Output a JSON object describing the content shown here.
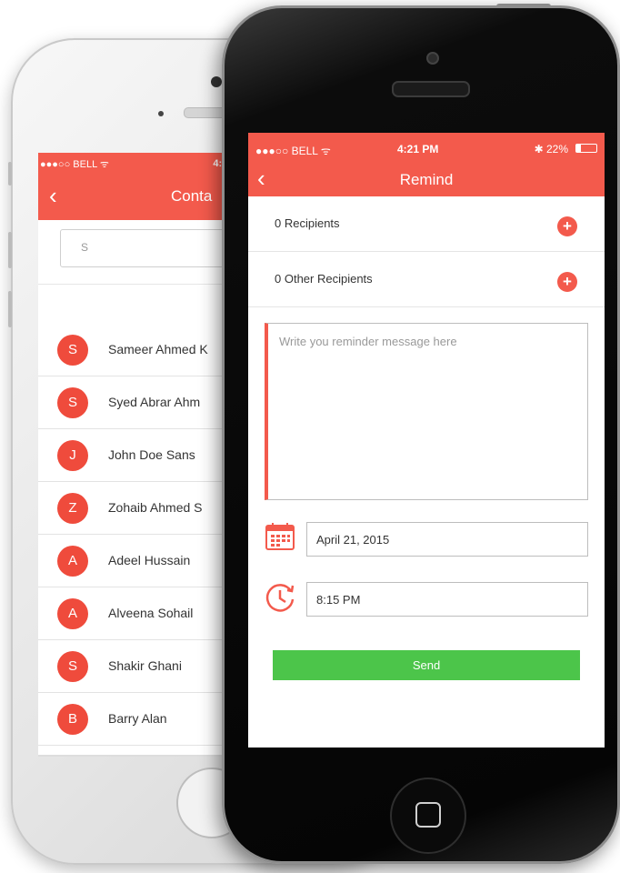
{
  "back_phone": {
    "status": {
      "carrier": "●●●○○ BELL ᯤ",
      "time": "4:21 PM"
    },
    "nav": {
      "back": "‹",
      "title": "Conta"
    },
    "search": {
      "value": "S"
    },
    "contacts": [
      {
        "initial": "S",
        "name": "Sameer Ahmed K"
      },
      {
        "initial": "S",
        "name": "Syed Abrar Ahm"
      },
      {
        "initial": "J",
        "name": "John Doe Sans"
      },
      {
        "initial": "Z",
        "name": "Zohaib Ahmed S"
      },
      {
        "initial": "A",
        "name": "Adeel Hussain"
      },
      {
        "initial": "A",
        "name": "Alveena Sohail"
      },
      {
        "initial": "S",
        "name": "Shakir Ghani"
      },
      {
        "initial": "B",
        "name": "Barry Alan"
      }
    ]
  },
  "front_phone": {
    "status": {
      "carrier": "●●●○○ BELL ᯤ",
      "time": "4:21 PM",
      "battery_text": "✱ 22%",
      "battery_level": 0.22
    },
    "nav": {
      "back": "‹",
      "title": "Remind"
    },
    "recipients": {
      "label": "0 Recipients",
      "add": "+"
    },
    "other_recipients": {
      "label": "0 Other Recipients",
      "add": "+"
    },
    "message": {
      "placeholder": "Write you reminder message here"
    },
    "date": {
      "value": "April 21, 2015",
      "icon": "calendar-icon"
    },
    "time": {
      "value": "8:15 PM",
      "icon": "clock-icon"
    },
    "send_label": "Send"
  },
  "colors": {
    "accent": "#f35a4c",
    "avatar": "#ef4b3c",
    "send": "#4cc54a"
  }
}
